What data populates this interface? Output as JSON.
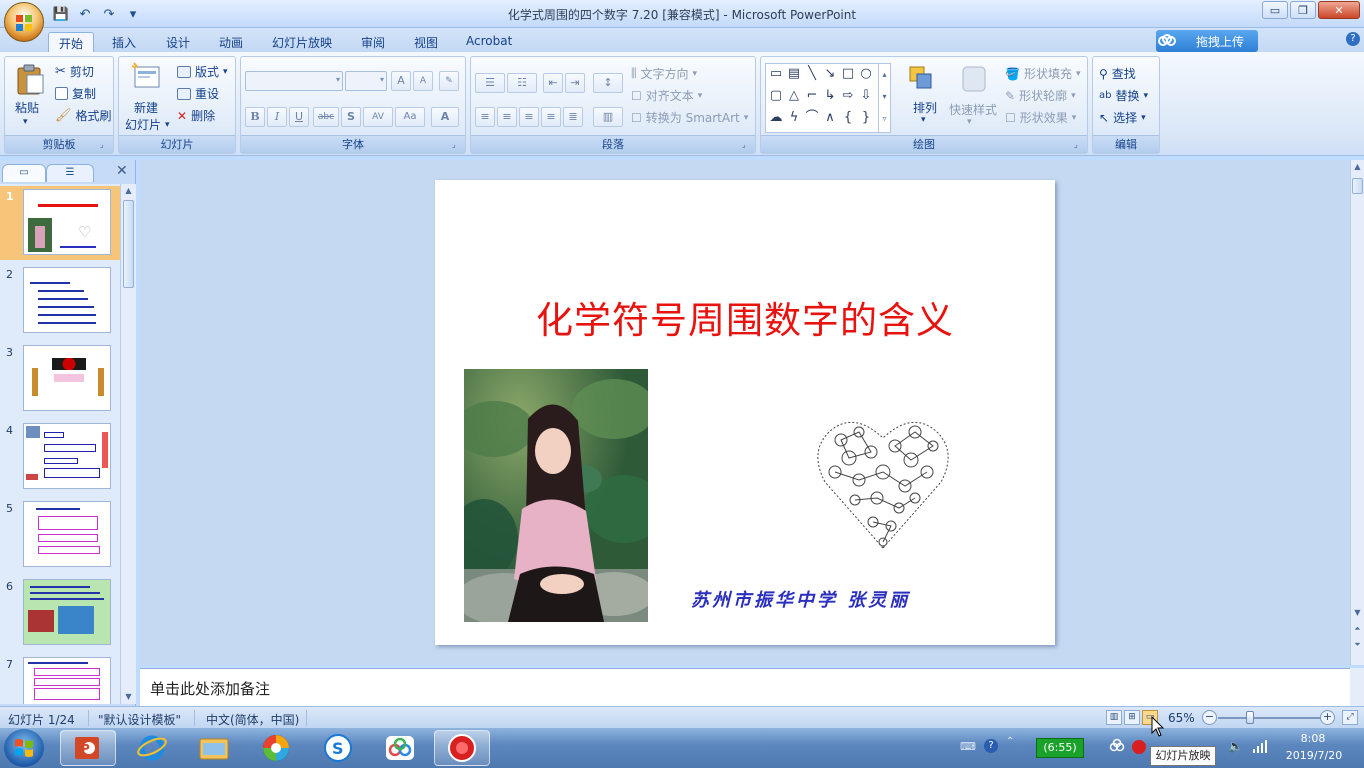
{
  "window": {
    "title": "化学式周围的四个数字 7.20 [兼容模式] - Microsoft PowerPoint",
    "controls": {
      "minimize": "▭",
      "restore": "❐",
      "close": "✕"
    }
  },
  "quick_access": [
    "💾",
    "↶",
    "↷",
    "▾"
  ],
  "ribbon": {
    "tabs": [
      {
        "label": "开始",
        "active": true
      },
      {
        "label": "插入"
      },
      {
        "label": "设计"
      },
      {
        "label": "动画"
      },
      {
        "label": "幻灯片放映"
      },
      {
        "label": "审阅"
      },
      {
        "label": "视图"
      },
      {
        "label": "Acrobat"
      }
    ],
    "upload_label": "拖拽上传",
    "help": "?",
    "groups": {
      "clipboard": {
        "name": "剪贴板",
        "paste": "粘贴",
        "cut": "剪切",
        "copy": "复制",
        "format_painter": "格式刷"
      },
      "slides": {
        "name": "幻灯片",
        "new_slide_1": "新建",
        "new_slide_2": "幻灯片",
        "layout": "版式",
        "reset": "重设",
        "delete": "删除"
      },
      "font": {
        "name": "字体",
        "bold": "B",
        "italic": "I",
        "underline": "U",
        "strike": "abc",
        "shadow": "S",
        "spacing": "AV",
        "case": "Aa",
        "color": "A",
        "grow": "A",
        "shrink": "A"
      },
      "paragraph": {
        "name": "段落",
        "text_direction": "文字方向",
        "align_text": "对齐文本",
        "smartart": "转换为 SmartArt"
      },
      "drawing": {
        "name": "绘图",
        "arrange": "排列",
        "quick_styles": "快速样式",
        "shape_fill": "形状填充",
        "shape_outline": "形状轮廓",
        "shape_effects": "形状效果"
      },
      "editing": {
        "name": "编辑",
        "find": "查找",
        "replace": "替换",
        "select": "选择"
      }
    }
  },
  "thumbnails": [
    {
      "num": "1",
      "selected": true
    },
    {
      "num": "2"
    },
    {
      "num": "3"
    },
    {
      "num": "4"
    },
    {
      "num": "5"
    },
    {
      "num": "6"
    },
    {
      "num": "7"
    }
  ],
  "slide": {
    "title": "化学符号周围数字的含义",
    "author": "苏州市振华中学  张灵丽"
  },
  "notes_placeholder": "单击此处添加备注",
  "status": {
    "slide_count": "幻灯片 1/24",
    "theme": "\"默认设计模板\"",
    "language": "中文(简体，中国)",
    "zoom": "65%",
    "zoom_level_percent": 65
  },
  "taskbar": {
    "battery": "(6:55)",
    "time": "8:08",
    "date": "2019/7/20",
    "tooltip": "幻灯片放映"
  },
  "colors": {
    "slide_title": "#e8120f",
    "author": "#2b2fbe",
    "ribbon_text": "#15428b"
  }
}
